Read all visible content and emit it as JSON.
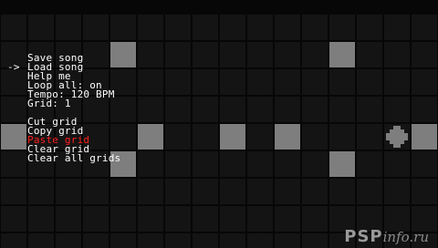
{
  "grid": {
    "cols": 16,
    "rows": 9,
    "colors": {
      "cell_off": "#141414",
      "cell_on": "#7e7e7e",
      "background": "#070707"
    },
    "active_cells": [
      [
        1,
        4
      ],
      [
        1,
        12
      ],
      [
        4,
        0
      ],
      [
        4,
        5
      ],
      [
        4,
        8
      ],
      [
        4,
        10
      ],
      [
        4,
        15
      ],
      [
        5,
        4
      ],
      [
        5,
        12
      ]
    ],
    "cursor": {
      "row": 4,
      "col": 14,
      "icon": "cross-cursor-icon"
    }
  },
  "menu": {
    "selected_index": 1,
    "selected_marker": "->",
    "items": [
      {
        "label": "Save song"
      },
      {
        "label": "Load song"
      },
      {
        "label": "Help me"
      },
      {
        "label": "Loop all: on"
      },
      {
        "label": "Tempo: 120 BPM"
      },
      {
        "label": "Grid: 1"
      },
      {
        "label": ""
      },
      {
        "label": "Cut grid"
      },
      {
        "label": "Copy grid"
      },
      {
        "label": "Paste grid",
        "color": "#ff2020"
      },
      {
        "label": "Clear grid"
      },
      {
        "label": "Clear all grids"
      }
    ]
  },
  "watermark": {
    "main": "PSP",
    "sub": "info.ru"
  }
}
